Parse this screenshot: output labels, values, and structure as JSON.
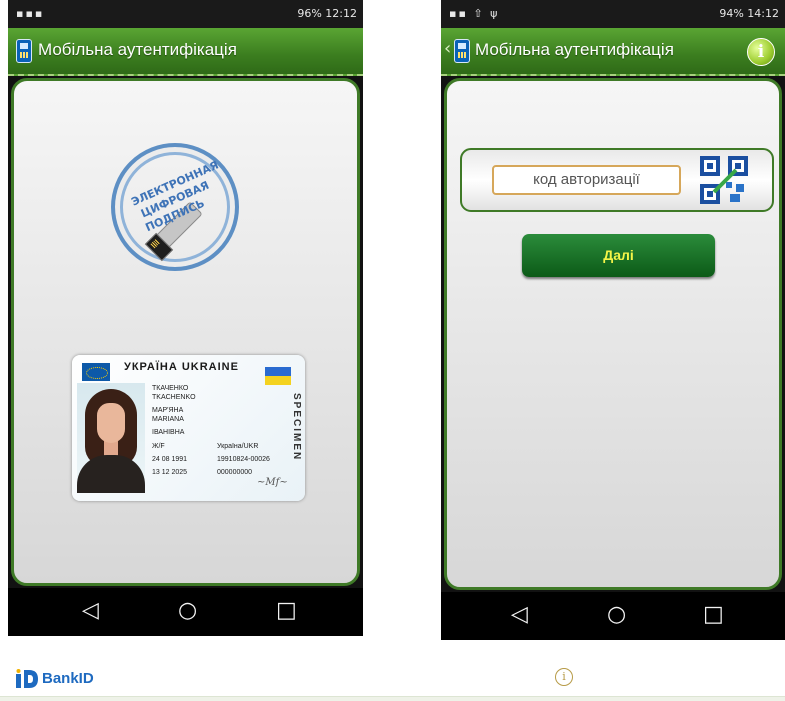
{
  "left_phone": {
    "status_bar": {
      "left": "",
      "right": "96%  12:12"
    },
    "app_title": "Мобільна аутентифікація",
    "stamp": {
      "line1": "ЭЛЕКТРОННАЯ",
      "line2": "ЦИФРОВАЯ",
      "line3": "ПОДПИСЬ"
    },
    "id_card": {
      "header": "УКРАЇНА UKRAINE",
      "specimen": "SPECIMEN",
      "surname_ua": "ТКАЧЕНКО",
      "surname_en": "TKACHENKO",
      "name_ua": "МАР'ЯНА",
      "name_en": "MARIANA",
      "patronymic": "ІВАНІВНА",
      "sex": "Ж/F",
      "nationality": "Україна/UKR",
      "birth_date": "24 08 1991",
      "record_no": "19910824-00026",
      "expiry": "13 12 2025",
      "doc_no": "000000000"
    }
  },
  "right_phone": {
    "status_bar": {
      "left": "",
      "right": "94%  14:12"
    },
    "app_title": "Мобільна аутентифікація",
    "back_icon": "chevron-left-icon",
    "info_icon": "info-icon",
    "auth_code_placeholder": "код авторизації",
    "next_button": "Далі"
  },
  "nav_buttons": {
    "back": "◁",
    "home": "○",
    "recent": "□"
  },
  "brand": {
    "name": "BankID",
    "color": "#1e6ac0"
  },
  "theme": {
    "green": "#3f7a27",
    "button_text": "#f5f548"
  }
}
